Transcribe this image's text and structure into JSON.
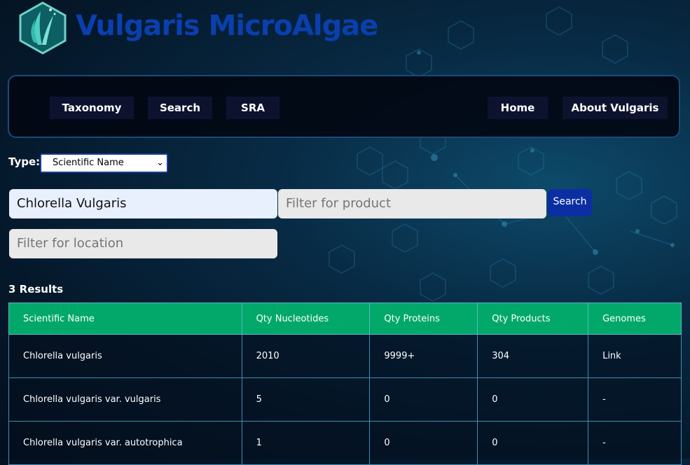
{
  "brand": {
    "title": "Vulgaris MicroAlgae"
  },
  "nav": {
    "taxonomy": "Taxonomy",
    "search": "Search",
    "sra": "SRA",
    "home": "Home",
    "about": "About Vulgaris"
  },
  "filters": {
    "type_label": "Type:",
    "type_selected": "Scientific Name",
    "name_value": "Chlorella Vulgaris",
    "product_placeholder": "Filter for product",
    "location_placeholder": "Filter for location",
    "search_button": "Search"
  },
  "results": {
    "count_label": "3 Results",
    "columns": [
      "Scientific Name",
      "Qty Nucleotides",
      "Qty Proteins",
      "Qty Products",
      "Genomes"
    ],
    "rows": [
      [
        "Chlorella vulgaris",
        "2010",
        "9999+",
        "304",
        "Link"
      ],
      [
        "Chlorella vulgaris var. vulgaris",
        "5",
        "0",
        "0",
        "-"
      ],
      [
        "Chlorella vulgaris var. autotrophica",
        "1",
        "0",
        "0",
        "-"
      ]
    ]
  },
  "colors": {
    "brand": "#0a3fae",
    "table_header": "#02a86a",
    "search_button": "#0b2fa3"
  }
}
